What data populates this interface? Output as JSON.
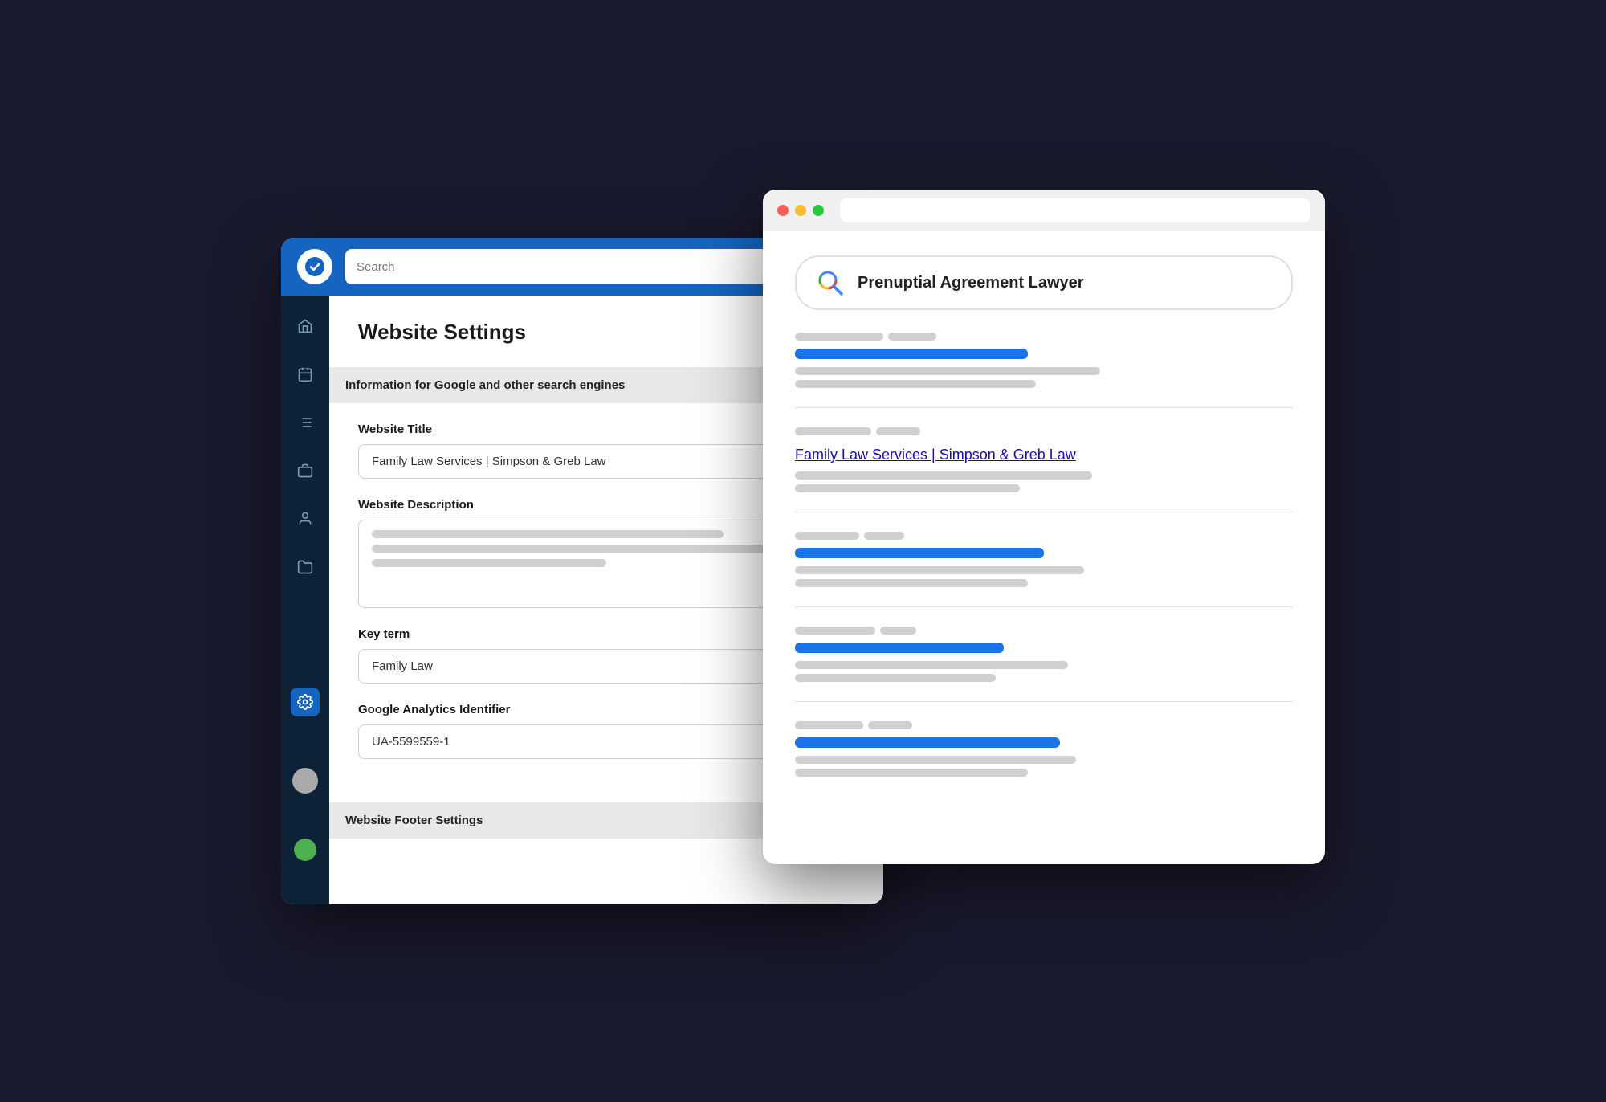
{
  "cms": {
    "topbar": {
      "search_placeholder": "Search"
    },
    "page_title": "Website Settings",
    "section_header": "Information for Google and other search engines",
    "footer_section_header": "Website Footer Settings",
    "fields": {
      "website_title_label": "Website Title",
      "website_title_value": "Family Law Services | Simpson & Greb Law",
      "website_description_label": "Website Description",
      "key_term_label": "Key term",
      "key_term_value": "Family Law",
      "analytics_label": "Google Analytics Identifier",
      "analytics_value": "UA-5599559-1"
    }
  },
  "browser": {
    "search_query": "Prenuptial Agreement Lawyer",
    "result_link": "Family Law Services | Simpson & Greb Law"
  },
  "sidebar": {
    "icons": [
      "home",
      "calendar",
      "list",
      "briefcase",
      "user",
      "folder",
      "settings"
    ]
  }
}
